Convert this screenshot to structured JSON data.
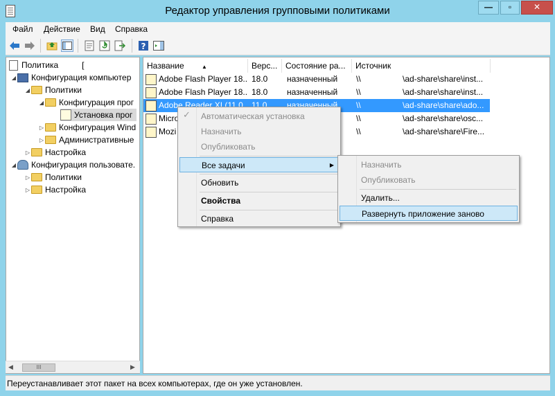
{
  "window": {
    "title": "Редактор управления групповыми политиками",
    "minimize_glyph": "—",
    "maximize_glyph": "▫",
    "close_glyph": "✕"
  },
  "menubar": [
    "Файл",
    "Действие",
    "Вид",
    "Справка"
  ],
  "toolbar": {
    "icons": [
      "back-arrow-icon",
      "forward-arrow-icon",
      "up-folder-icon",
      "show-hide-tree-icon",
      "properties-icon",
      "refresh-icon",
      "export-list-icon",
      "help-icon",
      "show-action-pane-icon"
    ]
  },
  "tree": {
    "root": "Политика",
    "computer_config": "Конфигурация компьютер",
    "policies": "Политики",
    "software_config": "Конфигурация прог",
    "software_install": "Установка прог",
    "windows_config": "Конфигурация Wind",
    "admin_templates": "Административные",
    "settings": "Настройка",
    "user_config": "Конфигурация пользовате.",
    "user_policies": "Политики",
    "user_settings": "Настройка",
    "scroll_grip": "III"
  },
  "list": {
    "columns": [
      "Название",
      "Верс...",
      "Состояние ра...",
      "Источник"
    ],
    "rows": [
      {
        "name": "Adobe Flash Player 18...",
        "version": "18.0",
        "state": "назначенный",
        "src1": "\\\\",
        "src2": "\\ad-share\\share\\inst..."
      },
      {
        "name": "Adobe Flash Player 18...",
        "version": "18.0",
        "state": "назначенный",
        "src1": "\\\\",
        "src2": "\\ad-share\\share\\inst..."
      },
      {
        "name": "Adobe Reader XI (11.0...",
        "version": "11.0",
        "state": "назначенный",
        "src1": "\\\\",
        "src2": "\\ad-share\\share\\ado..."
      },
      {
        "name": "Micro",
        "version": "",
        "state": "",
        "src1": "\\\\",
        "src2": "\\ad-share\\share\\osc..."
      },
      {
        "name": "Mozi",
        "version": "",
        "state": "",
        "src1": "\\\\",
        "src2": "\\ad-share\\share\\Fire..."
      }
    ]
  },
  "context_menu": {
    "items": [
      "Автоматическая установка",
      "Назначить",
      "Опубликовать",
      "Все задачи",
      "Обновить",
      "Свойства",
      "Справка"
    ],
    "check_glyph": "✓",
    "submenu_arrow": "▶"
  },
  "submenu": {
    "items": [
      "Назначить",
      "Опубликовать",
      "Удалить...",
      "Развернуть приложение заново"
    ]
  },
  "status": "Переустанавливает этот пакет на всех компьютерах, где он уже установлен."
}
